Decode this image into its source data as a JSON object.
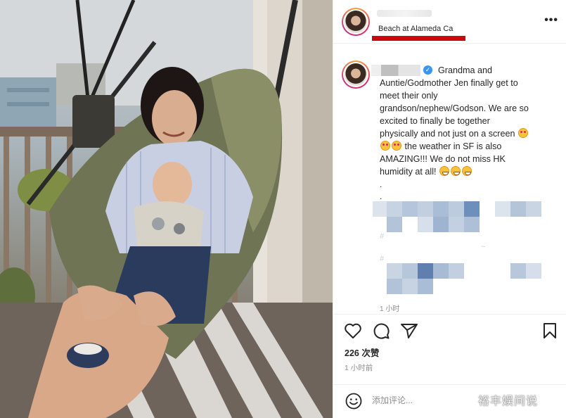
{
  "post": {
    "location": "Beach at Alameda Ca",
    "more_icon": "more-horizontal-icon"
  },
  "caption": {
    "line1": "Grandma and",
    "line2": "Auntie/Godmother Jen finally get to",
    "line3": "meet their only",
    "line4": "grandson/nephew/Godson. We are so",
    "line5": "excited to finally be together",
    "line6": "physically and not just on a screen",
    "line7": "the weather in SF is also",
    "line8": "AMAZING!!! We do not miss HK",
    "line9": "humidity at all!",
    "dot": ".",
    "comment_time": "1 小时"
  },
  "actions": {
    "like_icon": "heart-icon",
    "comment_icon": "comment-icon",
    "share_icon": "send-icon",
    "save_icon": "bookmark-icon",
    "likes": "226 次赞",
    "posted": "1 小时前"
  },
  "comment_box": {
    "placeholder": "添加评论...",
    "emoji_icon": "smiley-icon"
  },
  "watermark": "裕丰娱间说",
  "colors": {
    "verified": "#3897f0",
    "redaction": "#c80a0a",
    "ring": "#e1306c"
  }
}
